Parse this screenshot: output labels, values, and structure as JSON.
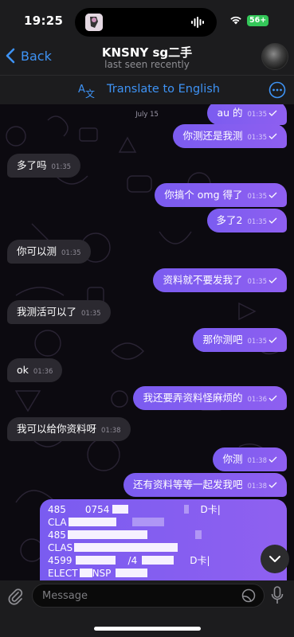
{
  "status_bar": {
    "time": "19:25",
    "battery": "56+"
  },
  "header": {
    "back_label": "Back",
    "title": "KNSNY sg二手",
    "subtitle": "last seen recently"
  },
  "translate_bar": {
    "label": "Translate to English"
  },
  "chat": {
    "date": "July 15",
    "messages": [
      {
        "dir": "out",
        "text": "au 的",
        "time": "01:35"
      },
      {
        "dir": "out",
        "text": "你测还是我测",
        "time": "01:35"
      },
      {
        "dir": "in",
        "text": "多了吗",
        "time": "01:35"
      },
      {
        "dir": "out",
        "text": "你搞个 omg 得了",
        "time": "01:35"
      },
      {
        "dir": "out",
        "text": "多了2",
        "time": "01:35"
      },
      {
        "dir": "in",
        "text": "你可以测",
        "time": "01:35"
      },
      {
        "dir": "out",
        "text": "资料就不要发我了",
        "time": "01:35"
      },
      {
        "dir": "in",
        "text": "我测活可以了",
        "time": "01:35"
      },
      {
        "dir": "out",
        "text": "那你测吧",
        "time": "01:35"
      },
      {
        "dir": "in",
        "text": "ok",
        "time": "01:36"
      },
      {
        "dir": "out",
        "text": "我还要弄资料怪麻烦的",
        "time": "01:36"
      },
      {
        "dir": "in",
        "text": "我可以给你资料呀",
        "time": "01:38"
      },
      {
        "dir": "out",
        "text": "你测",
        "time": "01:38"
      },
      {
        "dir": "out",
        "text": "还有资料等等一起发我吧",
        "time": "01:38"
      }
    ],
    "document_lines": [
      {
        "start": "485",
        "mid": "0754",
        "end": "D卡|"
      },
      {
        "start": "CLA",
        "mid": "",
        "end": ""
      },
      {
        "start": "485",
        "mid": "",
        "end": ""
      },
      {
        "start": "CLAS",
        "mid": "",
        "end": ""
      },
      {
        "start": "4599",
        "mid": "/4",
        "end": "D卡|"
      },
      {
        "start": "ELECT",
        "mid": "NSP",
        "end": ""
      }
    ]
  },
  "input_bar": {
    "placeholder": "Message"
  },
  "colors": {
    "accent": "#3e93f5",
    "outgoing_bubble": "#8a5ef0",
    "incoming_bubble": "#2b2930"
  }
}
